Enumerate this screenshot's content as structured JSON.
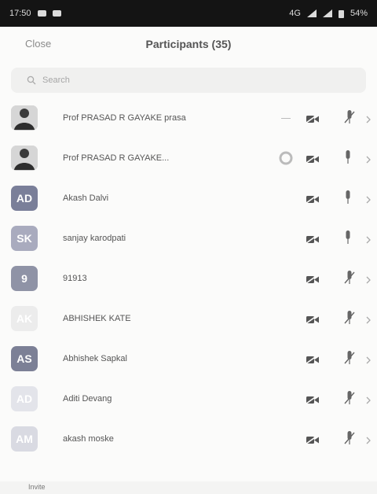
{
  "status_bar": {
    "time": "17:50",
    "network": "4G",
    "battery": "54%"
  },
  "header": {
    "close_label": "Close",
    "title": "Participants (35)"
  },
  "search": {
    "placeholder": "Search"
  },
  "participants": [
    {
      "name": "Prof PRASAD R GAYAKE prasa",
      "avatar_type": "photo",
      "initials": "",
      "color": "#cfcfcf",
      "video": "off",
      "mic": "muted",
      "extra": "dash"
    },
    {
      "name": "Prof PRASAD R GAYAKE...",
      "avatar_type": "photo",
      "initials": "",
      "color": "#cfcfcf",
      "video": "off",
      "mic": "on",
      "extra": "screen-share"
    },
    {
      "name": "Akash Dalvi",
      "avatar_type": "initials",
      "initials": "AD",
      "color": "#7a7f99",
      "video": "off",
      "mic": "on",
      "extra": ""
    },
    {
      "name": "sanjay karodpati",
      "avatar_type": "initials",
      "initials": "SK",
      "color": "#a9abbe",
      "video": "off",
      "mic": "on",
      "extra": ""
    },
    {
      "name": "91913",
      "avatar_type": "initials",
      "initials": "9",
      "color": "#8f93a6",
      "video": "off",
      "mic": "muted",
      "extra": ""
    },
    {
      "name": "ABHISHEK KATE",
      "avatar_type": "initials",
      "initials": "AK",
      "color": "#ececec",
      "video": "off",
      "mic": "muted",
      "extra": ""
    },
    {
      "name": "Abhishek Sapkal",
      "avatar_type": "initials",
      "initials": "AS",
      "color": "#7c8096",
      "video": "off",
      "mic": "muted",
      "extra": ""
    },
    {
      "name": "Aditi Devang",
      "avatar_type": "initials",
      "initials": "AD",
      "color": "#e3e4ea",
      "video": "off",
      "mic": "muted",
      "extra": ""
    },
    {
      "name": "akash moske",
      "avatar_type": "initials",
      "initials": "AM",
      "color": "#d9dae2",
      "video": "off",
      "mic": "muted",
      "extra": ""
    }
  ],
  "footer": {
    "invite_label": "Invite"
  }
}
